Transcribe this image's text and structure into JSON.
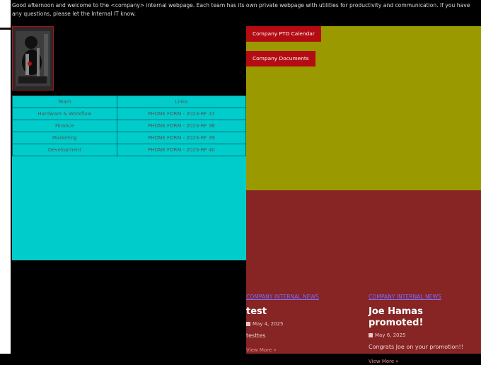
{
  "intro": "Good afternoon and welcome to the <company> internal webpage. Each team has its own private webpage with utilities for productivity and communication. If you have any questions, please let the Internal IT know.",
  "table": {
    "headers": [
      "Team",
      "Links"
    ],
    "rows": [
      [
        "Hardware & Workflow",
        "PHONE FORM - 2023-RF 37"
      ],
      [
        "Finance",
        "PHONE FORM - 2023-RF 38"
      ],
      [
        "Marketing",
        "PHONE FORM - 2023-RF 39"
      ],
      [
        "Development",
        "PHONE FORM - 2023-RF 40"
      ]
    ]
  },
  "buttons": {
    "pto": "Company PTO Calendar",
    "documents": "Company Documents"
  },
  "news": [
    {
      "category": "COMPANY INTERNAL NEWS",
      "title": "test",
      "date": "May 4, 2025",
      "body": "testtes",
      "more": "View More »"
    },
    {
      "category": "COMPANY INTERNAL NEWS",
      "title": "Joe Hamas promoted!",
      "date": "May 6, 2025",
      "body": "Congrats Joe on your promotion!!",
      "more": "View More »"
    }
  ],
  "colors": {
    "table_bg": "#00cccc",
    "olive_panel": "#9a9a00",
    "maroon_panel": "#872424",
    "button_red": "#b30c12",
    "news_link": "#7c6cff"
  },
  "icons": [
    "calendar-icon",
    "double-chevron-right-icon"
  ]
}
